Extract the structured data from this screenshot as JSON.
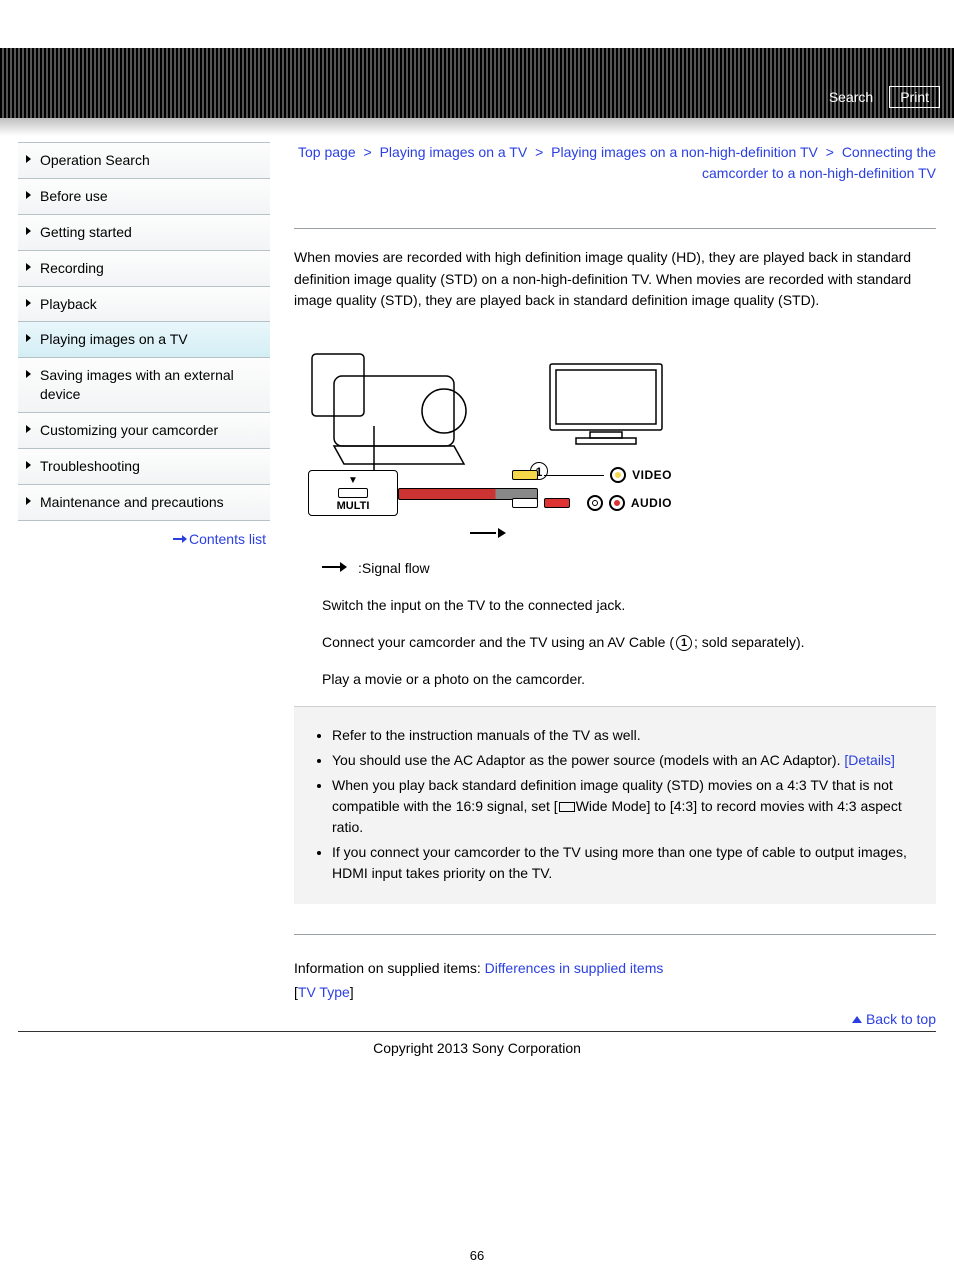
{
  "header": {
    "search": "Search",
    "print": "Print"
  },
  "sidebar": {
    "items": [
      "Operation Search",
      "Before use",
      "Getting started",
      "Recording",
      "Playback",
      "Playing images on a TV",
      "Saving images with an external device",
      "Customizing your camcorder",
      "Troubleshooting",
      "Maintenance and precautions"
    ],
    "active_index": 5,
    "contents_link": "Contents list"
  },
  "breadcrumb": {
    "parts": [
      "Top page",
      "Playing images on a TV",
      "Playing images on a non-high-definition TV",
      "Connecting the camcorder to a non-high-definition TV"
    ],
    "sep": ">"
  },
  "intro": "When movies are recorded with high definition image quality (HD), they are played back in standard definition image quality (STD) on a non-high-definition TV. When movies are recorded with standard image quality (STD), they are played back in standard definition image quality (STD).",
  "diagram": {
    "callout_1": "1",
    "multi_label": "MULTI",
    "video_label": "VIDEO",
    "audio_label": "AUDIO"
  },
  "steps": {
    "signal_flow": ":Signal flow",
    "step1": "Switch the input on the TV to the connected jack.",
    "step2_pre": "Connect your camcorder and the TV using an AV Cable (",
    "step2_mid": "1",
    "step2_post": "; sold separately).",
    "step3": "Play a movie or a photo on the camcorder."
  },
  "notes": {
    "n1": "Refer to the instruction manuals of the TV as well.",
    "n2_pre": "You should use the AC Adaptor as the power source (models with an AC Adaptor). ",
    "n2_link": "[Details]",
    "n3_pre": "When you play back standard definition image quality (STD) movies on a 4:3 TV that is not compatible with the 16:9 signal, set [",
    "n3_mid": "Wide Mode] to [4:3] to record movies with 4:3 aspect ratio.",
    "n4": "If you connect your camcorder to the TV using more than one type of cable to output images, HDMI input takes priority on the TV."
  },
  "supplied": {
    "lead": "Information on supplied items: ",
    "link1": "Differences in supplied items",
    "bracket_open": "[",
    "link2": "TV Type",
    "bracket_close": "]"
  },
  "back_to_top": "Back to top",
  "copyright": "Copyright 2013 Sony Corporation",
  "page_number": "66"
}
